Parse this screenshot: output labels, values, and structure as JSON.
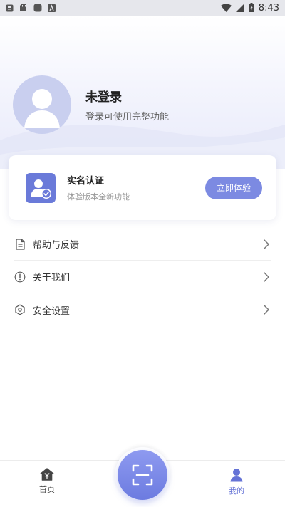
{
  "status_bar": {
    "time": "8:43",
    "icons": [
      "app-notification-icon",
      "sd-card-icon",
      "square-notification-icon",
      "a-notification-icon",
      "wifi-icon",
      "signal-icon",
      "battery-icon"
    ]
  },
  "profile": {
    "name": "未登录",
    "subtitle": "登录可使用完整功能"
  },
  "verify_card": {
    "title": "实名认证",
    "subtitle": "体验版本全新功能",
    "button_label": "立即体验",
    "accent_color": "#7c8ae2"
  },
  "menu": [
    {
      "label": "帮助与反馈",
      "icon": "document-icon"
    },
    {
      "label": "关于我们",
      "icon": "info-icon"
    },
    {
      "label": "安全设置",
      "icon": "settings-hex-icon"
    }
  ],
  "bottom_nav": {
    "home_label": "首页",
    "mine_label": "我的",
    "active_color": "#6573d6"
  }
}
